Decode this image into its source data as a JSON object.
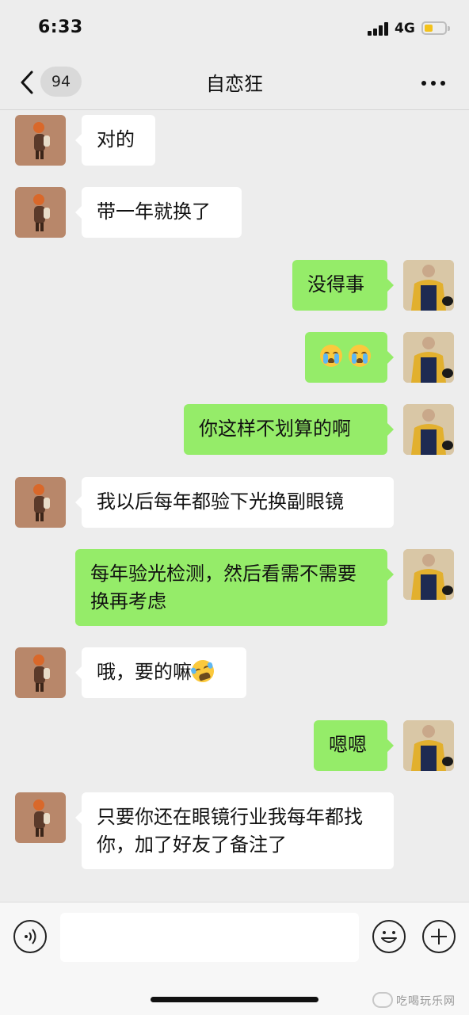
{
  "status_bar": {
    "time": "6:33",
    "network": "4G",
    "battery_level": 0.4
  },
  "header": {
    "unread_count": "94",
    "chat_title": "自恋狂"
  },
  "messages": [
    {
      "sender": "other",
      "text": "对的"
    },
    {
      "sender": "other",
      "text": "带一年就换了"
    },
    {
      "sender": "me",
      "text": "没得事"
    },
    {
      "sender": "me",
      "text": "",
      "emojis": [
        "crying-face-icon",
        "crying-face-icon"
      ]
    },
    {
      "sender": "me",
      "text": "你这样不划算的啊"
    },
    {
      "sender": "other",
      "text": "我以后每年都验下光换副眼镜"
    },
    {
      "sender": "me",
      "text": "每年验光检测，然后看需不需要换再考虑"
    },
    {
      "sender": "other",
      "text": "哦，要的嘛",
      "emojis": [
        "laughing-tears-icon"
      ]
    },
    {
      "sender": "me",
      "text": "嗯嗯"
    },
    {
      "sender": "other",
      "text": "只要你还在眼镜行业我每年都找你，加了好友了备注了"
    }
  ],
  "input_bar": {
    "placeholder": ""
  },
  "watermark": {
    "text": "吃喝玩乐网"
  },
  "colors": {
    "background": "#ededed",
    "outgoing_bubble": "#95ec69",
    "incoming_bubble": "#ffffff",
    "battery": "#f3c21b"
  }
}
